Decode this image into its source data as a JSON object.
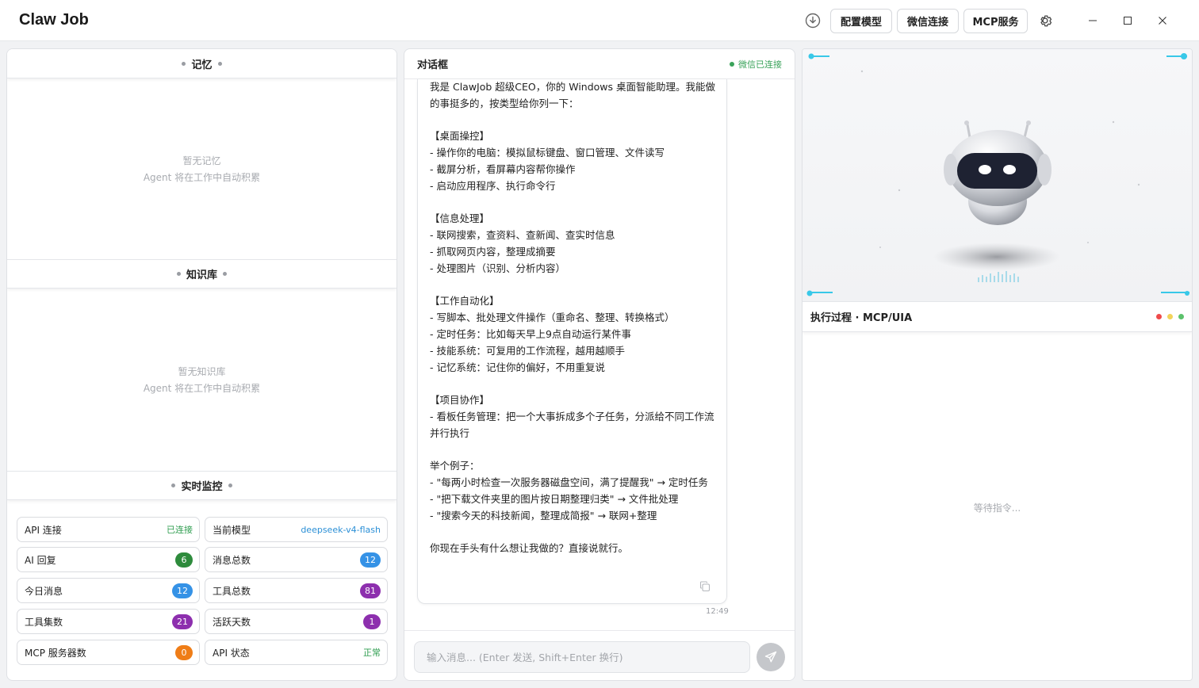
{
  "app": {
    "title": "Claw Job"
  },
  "toolbar": {
    "download_icon": "download-circle-icon",
    "config_model_label": "配置模型",
    "wechat_label": "微信连接",
    "mcp_label": "MCP服务",
    "settings_icon": "gear-icon"
  },
  "window_controls": {
    "minimize": "—",
    "maximize": "☐",
    "close": "✕"
  },
  "memory": {
    "title": "记忆",
    "empty_title": "暂无记忆",
    "empty_sub": "Agent 将在工作中自动积累"
  },
  "knowledge": {
    "title": "知识库",
    "empty_title": "暂无知识库",
    "empty_sub": "Agent 将在工作中自动积累"
  },
  "monitor": {
    "title": "实时监控",
    "stats": [
      {
        "label": "API 连接",
        "value": "已连接",
        "kind": "text",
        "color": "#2e9d4f"
      },
      {
        "label": "当前模型",
        "value": "deepseek-v4-flash",
        "kind": "text",
        "color": "#2b8fd6"
      },
      {
        "label": "AI 回复",
        "value": "6",
        "kind": "badge",
        "color": "#2e8b3c"
      },
      {
        "label": "消息总数",
        "value": "12",
        "kind": "badge",
        "color": "#3592e6"
      },
      {
        "label": "今日消息",
        "value": "12",
        "kind": "badge",
        "color": "#3592e6"
      },
      {
        "label": "工具总数",
        "value": "81",
        "kind": "badge",
        "color": "#8d2fae"
      },
      {
        "label": "工具集数",
        "value": "21",
        "kind": "badge",
        "color": "#8d2fae"
      },
      {
        "label": "活跃天数",
        "value": "1",
        "kind": "badge",
        "color": "#8d2fae"
      },
      {
        "label": "MCP 服务器数",
        "value": "0",
        "kind": "badge",
        "color": "#ef7d17"
      },
      {
        "label": "API 状态",
        "value": "正常",
        "kind": "text",
        "color": "#2e9d4f"
      }
    ]
  },
  "chat": {
    "title": "对话框",
    "wechat_status": "微信已连接",
    "message": "我是 ClawJob 超级CEO，你的 Windows 桌面智能助理。我能做的事挺多的，按类型给你列一下：\n\n【桌面操控】\n- 操作你的电脑：模拟鼠标键盘、窗口管理、文件读写\n- 截屏分析，看屏幕内容帮你操作\n- 启动应用程序、执行命令行\n\n【信息处理】\n- 联网搜索，查资料、查新闻、查实时信息\n- 抓取网页内容，整理成摘要\n- 处理图片（识别、分析内容）\n\n【工作自动化】\n- 写脚本、批处理文件操作（重命名、整理、转换格式）\n- 定时任务：比如每天早上9点自动运行某件事\n- 技能系统：可复用的工作流程，越用越顺手\n- 记忆系统：记住你的偏好，不用重复说\n\n【项目协作】\n- 看板任务管理：把一个大事拆成多个子任务，分派给不同工作流并行执行\n\n举个例子：\n- \"每两小时检查一次服务器磁盘空间，满了提醒我\" → 定时任务\n- \"把下载文件夹里的图片按日期整理归类\" → 文件批处理\n- \"搜索今天的科技新闻，整理成简报\" → 联网+整理\n\n你现在手头有什么想让我做的？直接说就行。",
    "time": "12:49",
    "input_placeholder": "输入消息... (Enter 发送, Shift+Enter 换行)",
    "send_icon": "send-icon",
    "copy_icon": "copy-icon"
  },
  "execution": {
    "title": "执行过程 · MCP/UIA",
    "waiting": "等待指令...",
    "light_colors": [
      "#ef4b4b",
      "#f2d35a",
      "#5cc26c"
    ],
    "robot": "robot-avatar"
  }
}
